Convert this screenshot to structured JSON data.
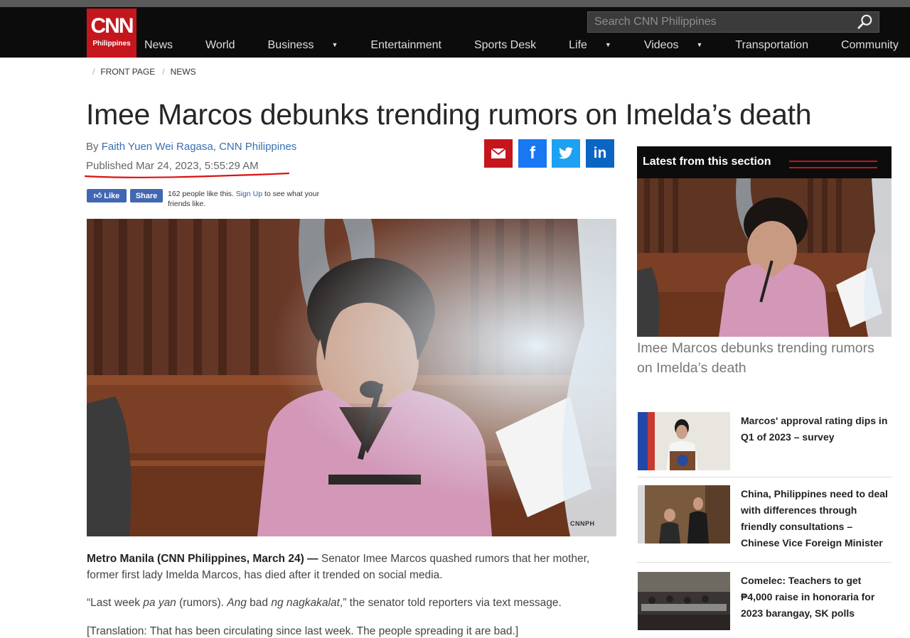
{
  "header": {
    "logo": {
      "big": "CNN",
      "small": "Philippines"
    },
    "search": {
      "placeholder": "Search CNN Philippines"
    },
    "nav": [
      {
        "label": "News",
        "dropdown": false
      },
      {
        "label": "World",
        "dropdown": false
      },
      {
        "label": "Business",
        "dropdown": true
      },
      {
        "label": "Entertainment",
        "dropdown": false
      },
      {
        "label": "Sports Desk",
        "dropdown": false
      },
      {
        "label": "Life",
        "dropdown": true
      },
      {
        "label": "Videos",
        "dropdown": true
      },
      {
        "label": "Transportation",
        "dropdown": false
      },
      {
        "label": "Community",
        "dropdown": true
      }
    ]
  },
  "breadcrumb": [
    "FRONT PAGE",
    "NEWS"
  ],
  "article": {
    "title": "Imee Marcos debunks trending rumors on Imelda’s death",
    "by_prefix": "By ",
    "author": "Faith Yuen Wei Ragasa, CNN Philippines",
    "published": "Published Mar 24, 2023, 5:55:29 AM",
    "share": {
      "email": "email-share",
      "facebook": "f",
      "twitter": "twitter-share",
      "linkedin": "in"
    },
    "fb_widget": {
      "like": "Like",
      "share": "Share",
      "count_text": "162 people like this.",
      "signup": "Sign Up",
      "signup_suffix": " to see what your friends like."
    },
    "image_credit": "CNNPH",
    "lead_dateline": "Metro Manila (CNN Philippines, March 24) —",
    "lead_text": " Senator Imee Marcos quashed rumors that her mother, former first lady Imelda Marcos, has died after it trended on social media.",
    "quote_parts": [
      "“Last week ",
      "pa yan",
      " (rumors). ",
      "Ang",
      " bad ",
      "ng nagkakalat",
      ",” the senator told reporters via text message."
    ],
    "translation": "[Translation: That has been circulating since last week. The people spreading it are bad.]"
  },
  "sidebar": {
    "heading": "Latest from this section",
    "featured_title": "Imee Marcos debunks trending rumors on Imelda’s death",
    "items": [
      {
        "title": "Marcos' approval rating dips in Q1 of 2023 – survey"
      },
      {
        "title": "China, Philippines need to deal with differences through friendly consultations – Chinese Vice Foreign Minister"
      },
      {
        "title": "Comelec: Teachers to get ₱4,000 raise in honoraria for 2023 barangay, SK polls"
      }
    ]
  },
  "colors": {
    "brand_red": "#c4161c",
    "facebook": "#3b5998",
    "twitter": "#1da1f2",
    "linkedin": "#0077b5",
    "email": "#c4161c"
  }
}
